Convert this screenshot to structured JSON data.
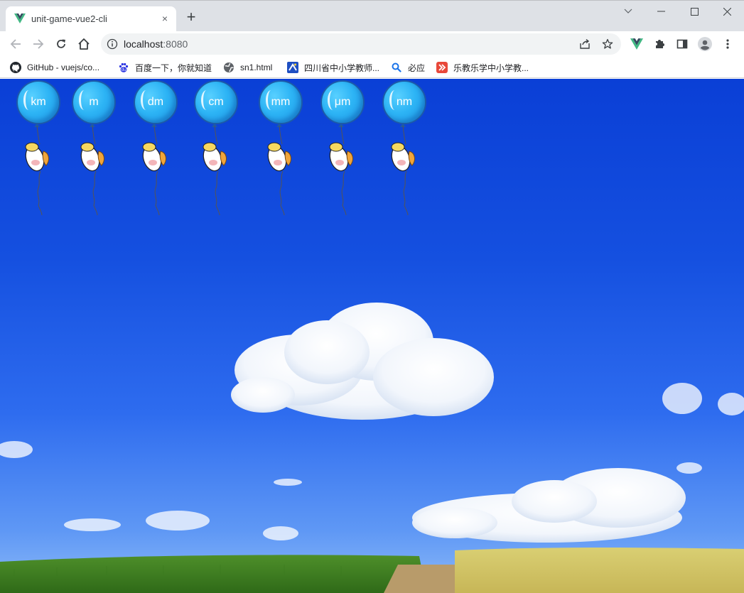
{
  "browser": {
    "tab_title": "unit-game-vue2-cli",
    "tab_close": "×",
    "new_tab": "+",
    "url_host": "localhost",
    "url_port": ":8080"
  },
  "bookmarks": [
    {
      "label": "GitHub - vuejs/co...",
      "icon": "github-icon"
    },
    {
      "label": "百度一下，你就知道",
      "icon": "baidu-icon"
    },
    {
      "label": "sn1.html",
      "icon": "globe-icon"
    },
    {
      "label": "四川省中小学教师...",
      "icon": "sichuan-edu-icon"
    },
    {
      "label": "必应",
      "icon": "bing-search-icon"
    },
    {
      "label": "乐教乐学中小学教...",
      "icon": "lejiaolexue-icon"
    }
  ],
  "game": {
    "balloons": [
      "km",
      "m",
      "dm",
      "cm",
      "mm",
      "μm",
      "nm"
    ]
  },
  "colors": {
    "balloon": "#2db4f5",
    "sky_top": "#0a3fd6",
    "sky_bottom": "#8dbaf8",
    "vue_green": "#42b883"
  }
}
